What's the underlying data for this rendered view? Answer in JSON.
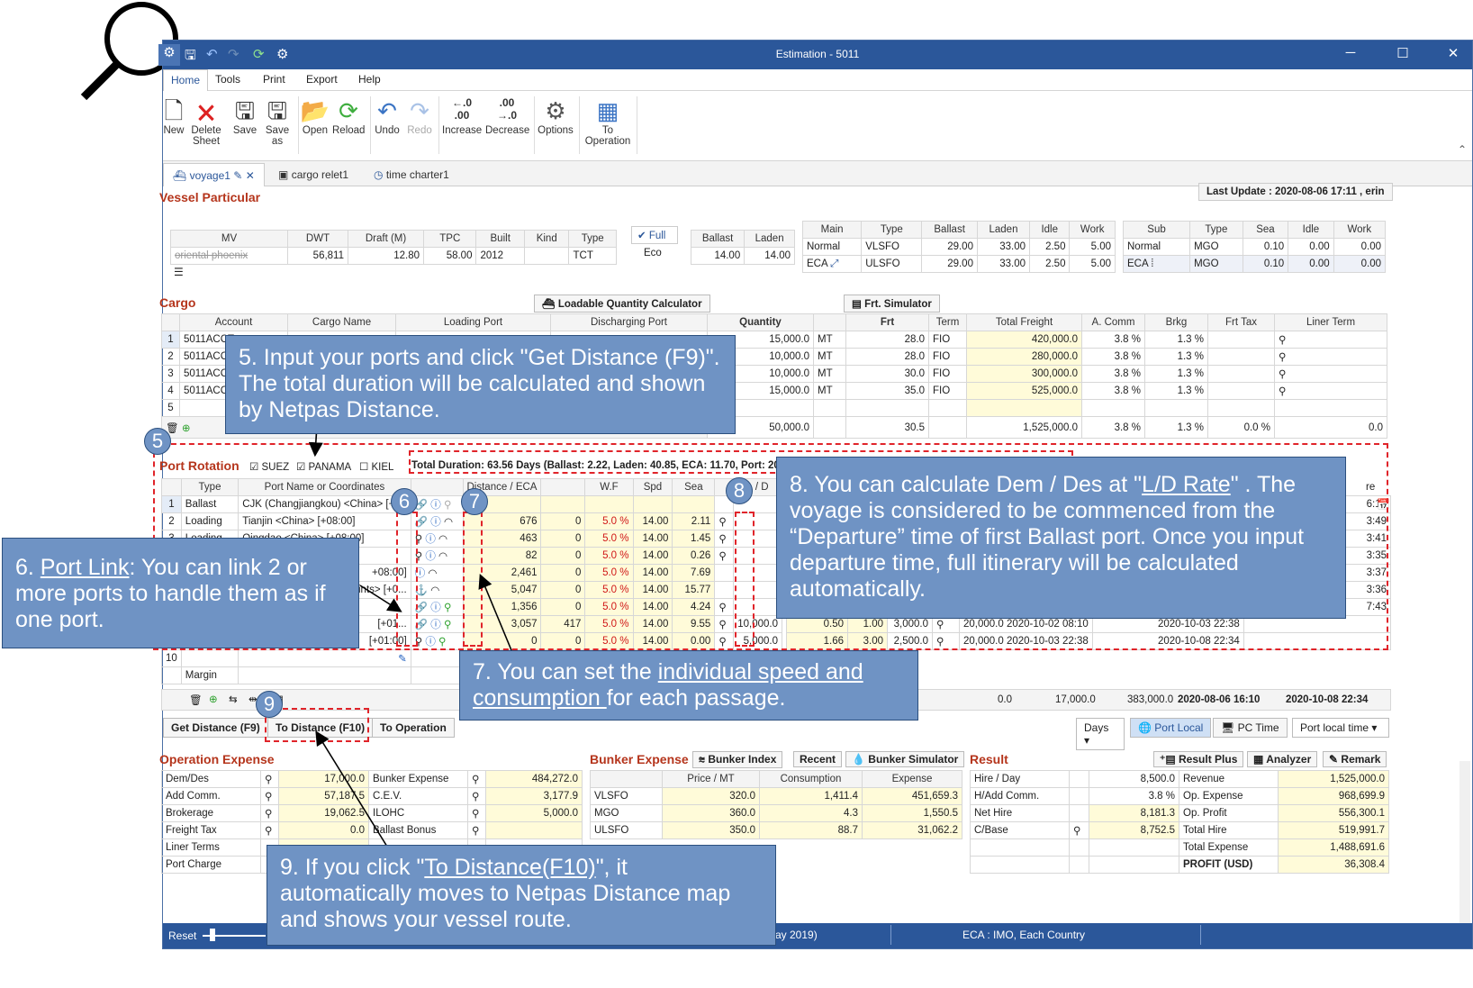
{
  "window": {
    "title": "Estimation - 5011"
  },
  "menu": [
    "Home",
    "Tools",
    "Print",
    "Export",
    "Help"
  ],
  "ribbon": {
    "new": "New",
    "delete_1": "Delete",
    "delete_2": "Sheet",
    "save": "Save",
    "saveas_1": "Save",
    "saveas_2": "as",
    "open": "Open",
    "reload": "Reload",
    "undo": "Undo",
    "redo": "Redo",
    "increase": "Increase",
    "decrease": "Decrease",
    "options": "Options",
    "toop_1": "To",
    "toop_2": "Operation",
    "inc_1": "←.0",
    "inc_2": ".00",
    "dec_1": ".00",
    "dec_2": "→.0"
  },
  "doc_tabs": [
    "voyage1",
    "cargo relet1",
    "time charter1"
  ],
  "vessel": {
    "title": "Vessel Particular",
    "last_update": "Last Update : 2020-08-06 17:11 , erin",
    "headers": [
      "MV",
      "DWT",
      "Draft (M)",
      "TPC",
      "Built",
      "Kind",
      "Type"
    ],
    "row": [
      "oriental phoenix",
      "56,811",
      "12.80",
      "58.00",
      "2012",
      "",
      "TCT"
    ],
    "full": "✔ Full",
    "eco": "Eco",
    "speed_headers": [
      "Ballast",
      "Laden"
    ],
    "speed_row": [
      "14.00",
      "14.00"
    ],
    "main_headers": [
      "Main",
      "Type",
      "Ballast",
      "Laden",
      "Idle",
      "Work"
    ],
    "main_rows": [
      [
        "Normal",
        "VLSFO",
        "29.00",
        "33.00",
        "2.50",
        "5.00"
      ],
      [
        "ECA",
        "ULSFO",
        "29.00",
        "33.00",
        "2.50",
        "5.00"
      ]
    ],
    "sub_headers": [
      "Sub",
      "Type",
      "Sea",
      "Idle",
      "Work"
    ],
    "sub_rows": [
      [
        "Normal",
        "MGO",
        "0.10",
        "0.00",
        "0.00"
      ],
      [
        "ECA",
        "MGO",
        "0.10",
        "0.00",
        "0.00"
      ]
    ]
  },
  "cargo": {
    "title": "Cargo",
    "btn_lqc": "Loadable Quantity Calculator",
    "btn_frt": "Frt. Simulator",
    "headers": [
      "",
      "Account",
      "Cargo Name",
      "Loading Port",
      "Discharging Port",
      "Quantity",
      "",
      "Frt",
      "Term",
      "Total Freight",
      "A. Comm",
      "Brkg",
      "Frt Tax",
      "Liner Term"
    ],
    "rows": [
      [
        "1",
        "5011ACCT",
        "15,000.0",
        "MT",
        "28.0",
        "FIO",
        "420,000.0",
        "3.8 %",
        "1.3 %"
      ],
      [
        "2",
        "5011ACCT",
        "10,000.0",
        "MT",
        "28.0",
        "FIO",
        "280,000.0",
        "3.8 %",
        "1.3 %"
      ],
      [
        "3",
        "5011ACCT",
        "10,000.0",
        "MT",
        "30.0",
        "FIO",
        "300,000.0",
        "3.8 %",
        "1.3 %"
      ],
      [
        "4",
        "5011ACCT",
        "15,000.0",
        "MT",
        "35.0",
        "FIO",
        "525,000.0",
        "3.8 %",
        "1.3 %"
      ],
      [
        "5",
        "",
        "",
        "",
        "",
        "",
        "",
        "",
        ""
      ]
    ],
    "totals": [
      "50,000.0",
      "30.5",
      "1,525,000.0",
      "3.8 %",
      "1.3 %",
      "0.0 %",
      "0.0"
    ]
  },
  "port_rotation": {
    "title": "Port Rotation",
    "suez": "SUEZ",
    "panama": "PANAMA",
    "kiel": "KIEL",
    "total_duration": "Total Duration: 63.56 Days (Ballast: 2.22, Laden: 40.85, ECA: 11.70, Port: 20.4",
    "headers": [
      "",
      "Type",
      "Port Name or Coordinates",
      "Distance / ECA",
      "",
      "W.F",
      "Spd",
      "Sea",
      "L / D"
    ],
    "rows": [
      [
        "1",
        "Ballast",
        "CJK (Changjiangkou) <China> [+",
        "",
        "",
        "",
        "",
        ""
      ],
      [
        "2",
        "Loading",
        "Tianjin <China> [+08:00]",
        "676",
        "0",
        "5.0 %",
        "14.00",
        "2.11"
      ],
      [
        "3",
        "Loading",
        "Qingdao <China> [+08:00]",
        "463",
        "0",
        "5.0 %",
        "14.00",
        "1.45"
      ],
      [
        "4",
        "",
        "",
        "82",
        "0",
        "5.0 %",
        "14.00",
        "0.26"
      ],
      [
        "5",
        "",
        "+08:00]",
        "2,461",
        "0",
        "5.0 %",
        "14.00",
        "7.69"
      ],
      [
        "6",
        "",
        "oints> [+0...",
        "5,047",
        "0",
        "5.0 %",
        "14.00",
        "15.77"
      ],
      [
        "7",
        "",
        "",
        "1,356",
        "0",
        "5.0 %",
        "14.00",
        "4.24"
      ],
      [
        "8",
        "",
        "[+01...",
        "3,057",
        "417",
        "5.0 %",
        "14.00",
        "9.55"
      ],
      [
        "9",
        "",
        "[+01:00]",
        "0",
        "0",
        "5.0 %",
        "14.00",
        "0.00"
      ],
      [
        "10",
        "",
        "",
        "",
        "",
        "",
        "",
        ""
      ]
    ],
    "right_rows": [
      [
        "",
        "",
        "",
        "",
        "",
        "",
        "6:10"
      ],
      [
        "",
        "",
        "",
        "",
        "",
        "",
        "3:49"
      ],
      [
        "",
        "",
        "",
        "",
        "",
        "",
        "3:41"
      ],
      [
        "",
        "",
        "",
        "",
        "",
        "",
        "3:35"
      ],
      [
        "",
        "",
        "",
        "",
        "",
        "",
        "3:37"
      ],
      [
        "",
        "",
        "",
        "",
        "",
        "",
        "3:36"
      ],
      [
        "",
        "",
        "",
        "",
        "",
        "",
        "7:43"
      ],
      [
        "10,000.0",
        "0.50",
        "1.00",
        "3,000.0",
        "20,000.0 2020-10-02 08:10",
        "2020-10-03 22:38",
        ""
      ],
      [
        "5,000.0",
        "1.66",
        "3.00",
        "2,500.0",
        "20,000.0 2020-10-03 22:38",
        "2020-10-08 22:34",
        ""
      ]
    ],
    "margin": "Margin",
    "footer": [
      "0.0",
      "17,000.0",
      "383,000.0",
      "2020-08-06 16:10",
      "2020-10-08 22:34"
    ],
    "re": "re"
  },
  "buttons": {
    "get_distance": "Get Distance (F9)",
    "to_distance": "To Distance (F10)",
    "to_operation": "To Operation",
    "days": "Days",
    "port_local": "Port Local",
    "pc_time": "PC Time",
    "port_local_time": "Port local time"
  },
  "opex": {
    "title": "Operation Expense",
    "rows": [
      [
        "Dem/Des",
        "17,000.0"
      ],
      [
        "Add Comm.",
        "57,187.5"
      ],
      [
        "Brokerage",
        "19,062.5"
      ],
      [
        "Freight Tax",
        "0.0"
      ],
      [
        "Liner Terms",
        ""
      ],
      [
        "Port Charge",
        ""
      ]
    ],
    "rows2": [
      [
        "Bunker Expense",
        "484,272.0"
      ],
      [
        "C.E.V.",
        "3,177.9"
      ],
      [
        "ILOHC",
        "5,000.0"
      ],
      [
        "Ballast Bonus",
        ""
      ]
    ]
  },
  "bunker": {
    "title": "Bunker Expense",
    "btn_index": "Bunker Index",
    "btn_recent": "Recent",
    "btn_sim": "Bunker Simulator",
    "headers": [
      "",
      "Price / MT",
      "Consumption",
      "Expense"
    ],
    "rows": [
      [
        "VLSFO",
        "320.0",
        "1,411.4",
        "451,659.3"
      ],
      [
        "MGO",
        "360.0",
        "4.3",
        "1,550.5"
      ],
      [
        "ULSFO",
        "350.0",
        "88.7",
        "31,062.2"
      ]
    ]
  },
  "result": {
    "title": "Result",
    "btn_plus": "Result Plus",
    "btn_analyzer": "Analyzer",
    "btn_remark": "Remark",
    "left": [
      [
        "Hire / Day",
        "8,500.0"
      ],
      [
        "H/Add Comm.",
        "3.8 %"
      ],
      [
        "Net Hire",
        "8,181.3"
      ],
      [
        "C/Base",
        "8,752.5"
      ]
    ],
    "right": [
      [
        "Revenue",
        "1,525,000.0"
      ],
      [
        "Op. Expense",
        "968,699.9"
      ],
      [
        "Op. Profit",
        "556,300.1"
      ],
      [
        "Total Hire",
        "519,991.7"
      ],
      [
        "Total Expense",
        "1,488,691.6"
      ],
      [
        "PROFIT (USD)",
        "36,308.4"
      ]
    ]
  },
  "status": {
    "reset": "Reset",
    "mid": "ay 2019)",
    "eca": "ECA : IMO, Each Country"
  },
  "callouts": {
    "c5": "5. Input your ports and click \"Get Distance (F9)\". The total duration will be calculated and shown by Netpas Distance.",
    "c6_a": "6. ",
    "c6_u": "Port Link",
    "c6_b": ":  You can link 2 or more ports to handle them as if one port.",
    "c7_a": "7. You can set  the ",
    "c7_u": "individual speed and consumption ",
    "c7_b": " for each passage.",
    "c8_a": "8. You can calculate Dem / Des at \"",
    "c8_u": "L/D Rate",
    "c8_b": "\" . The voyage is considered to be commenced from the  “Departure” time of first Ballast port. Once you input departure time, full itinerary will be calculated automatically.",
    "c9_a": "9.  If you click \"",
    "c9_u": "To Distance(F10)",
    "c9_b": "\", it automatically moves to Netpas Distance map and shows your vessel route.",
    "n5": "5",
    "n6": "6",
    "n7": "7",
    "n8": "8",
    "n9": "9"
  }
}
